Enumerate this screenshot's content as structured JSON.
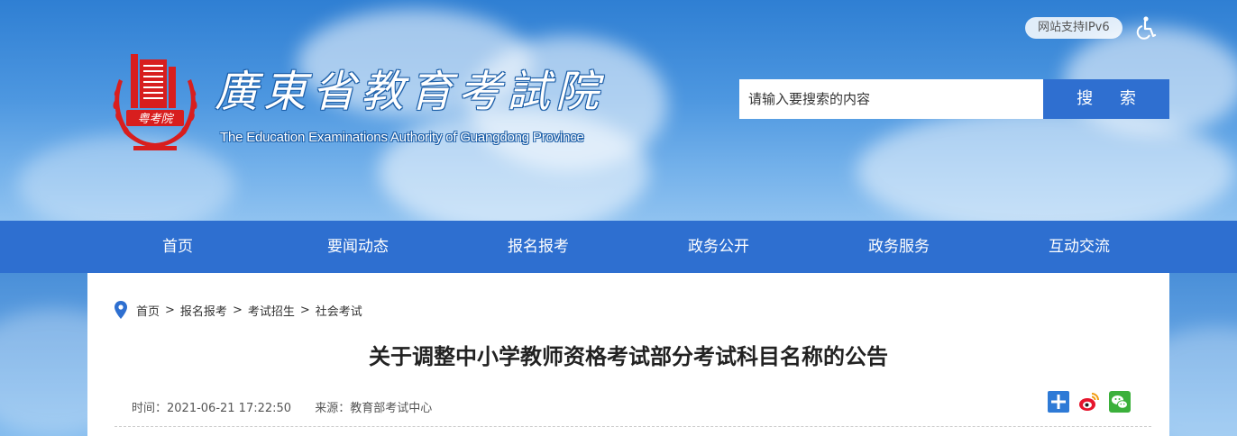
{
  "header": {
    "title_cn": "廣東省教育考試院",
    "title_en": "The Education Examinations Authority of Guangdong Province",
    "logo_seal_text": "粤考院",
    "ipv6_label": "网站支持IPv6",
    "search_placeholder": "请输入要搜索的内容",
    "search_button": "搜 索"
  },
  "nav": {
    "items": [
      {
        "label": "首页"
      },
      {
        "label": "要闻动态"
      },
      {
        "label": "报名报考"
      },
      {
        "label": "政务公开"
      },
      {
        "label": "政务服务"
      },
      {
        "label": "互动交流"
      }
    ]
  },
  "breadcrumb": {
    "items": [
      "首页",
      "报名报考",
      "考试招生",
      "社会考试"
    ],
    "separator": ">"
  },
  "article": {
    "title": "关于调整中小学教师资格考试部分考试科目名称的公告",
    "time": "时间：2021-06-21 17:22:50",
    "source": "来源：教育部考试中心"
  },
  "share": {
    "icons": [
      "add-share-icon",
      "weibo-icon",
      "wechat-icon"
    ]
  },
  "colors": {
    "nav_bg": "#2e6fd0",
    "search_button_bg": "#2f6fd0",
    "logo_red": "#d81e1e"
  }
}
